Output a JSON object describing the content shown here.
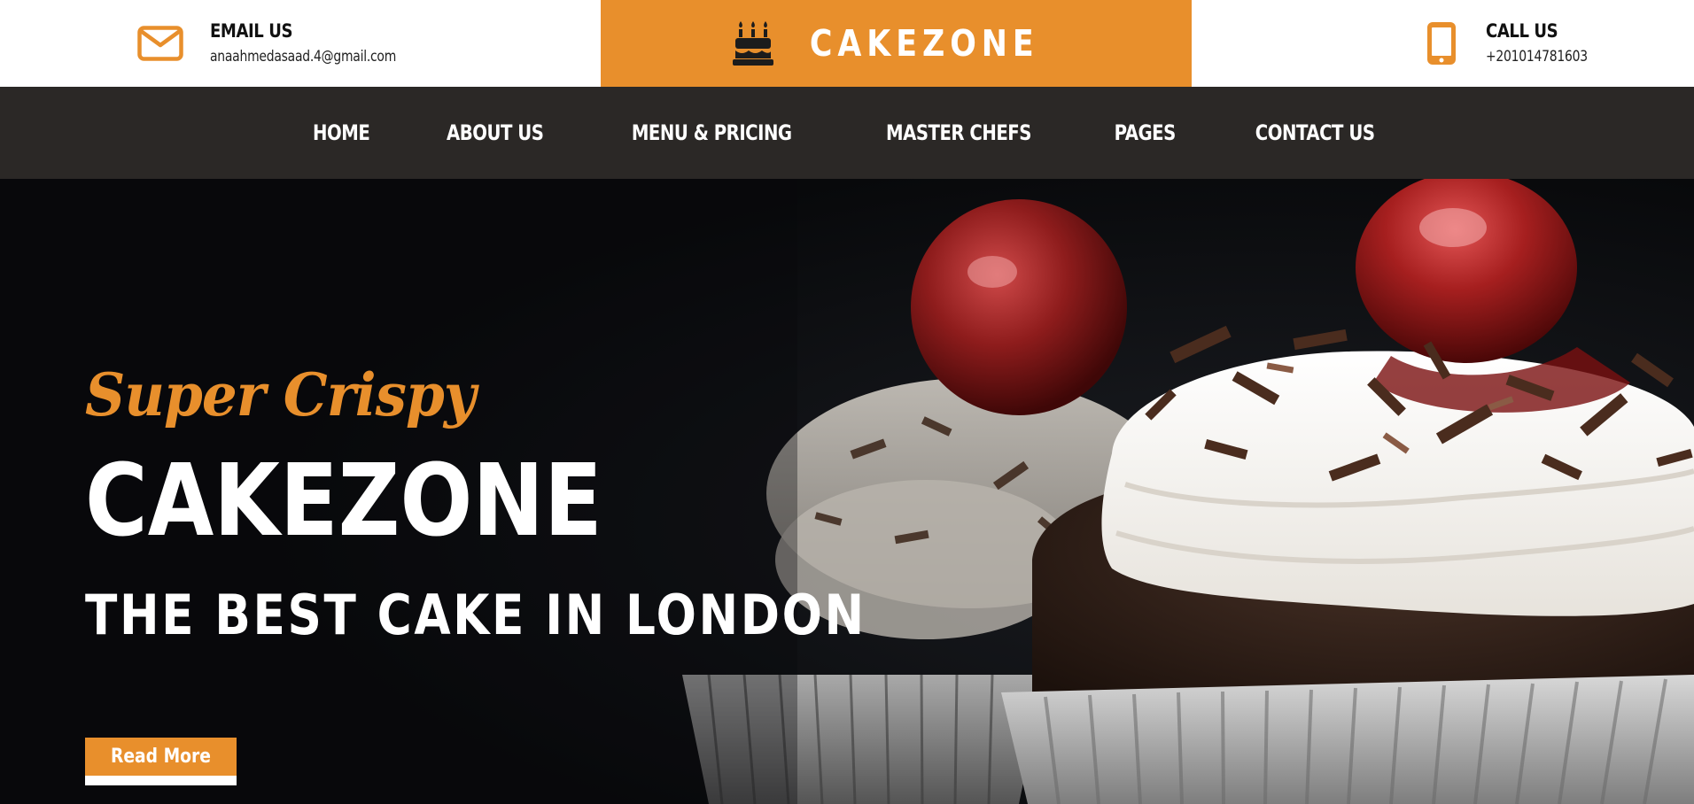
{
  "topbar": {
    "email": {
      "icon": "envelope-icon",
      "title": "EMAIL US",
      "value": "anaahmedasaad.4@gmail.com"
    },
    "brand": {
      "icon": "birthday-cake-icon",
      "name": "CAKEZONE"
    },
    "phone": {
      "icon": "mobile-phone-icon",
      "title": "CALL US",
      "value": "+201014781603"
    }
  },
  "nav": {
    "items": [
      {
        "label": "HOME"
      },
      {
        "label": "ABOUT US"
      },
      {
        "label": "MENU & PRICING"
      },
      {
        "label": "MASTER CHEFS"
      },
      {
        "label": "PAGES"
      },
      {
        "label": "CONTACT US"
      }
    ]
  },
  "hero": {
    "script_text": "Super Crispy",
    "title": "CAKEZONE",
    "subtitle": "THE BEST CAKE IN LONDON",
    "button_label": "Read More",
    "image": "black-forest-cupcakes-with-cherries"
  },
  "colors": {
    "accent": "#e88f2c",
    "nav_bg": "#2b2826",
    "hero_bg": "#0b0c0e",
    "text_dark": "#111111"
  }
}
